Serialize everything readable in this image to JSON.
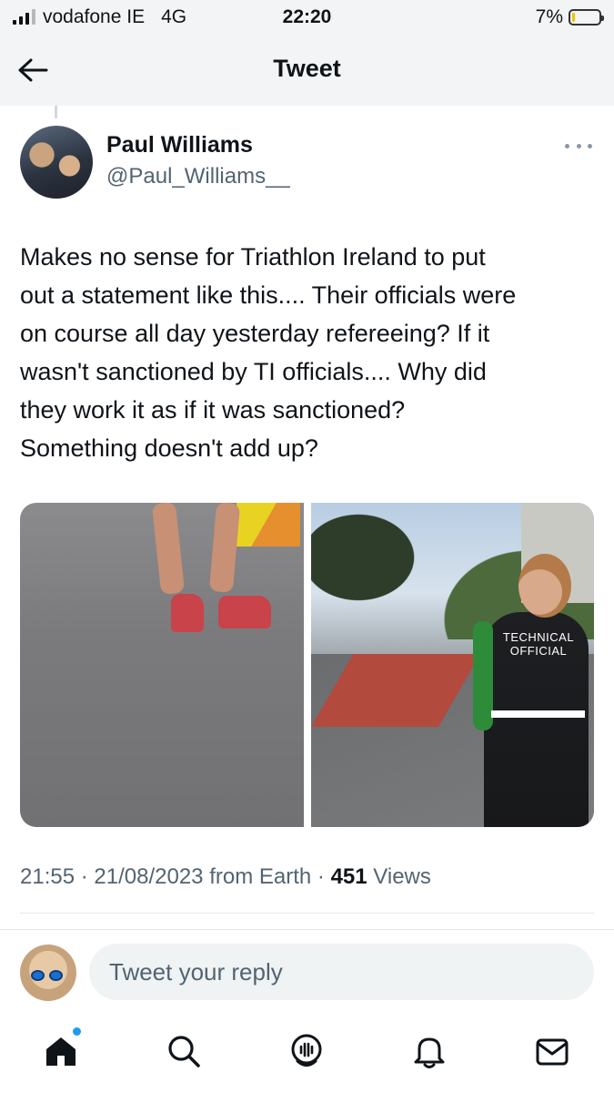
{
  "status_bar": {
    "carrier": "vodafone IE",
    "network": "4G",
    "time": "22:20",
    "battery_percent": "7%",
    "battery_level": 0.07,
    "signal_bars_active": 3,
    "signal_bars_total": 4
  },
  "header": {
    "back_icon": "arrow-left-icon",
    "title": "Tweet"
  },
  "tweet": {
    "author_name": "Paul Williams",
    "author_handle": "@Paul_Williams__",
    "more_icon": "more-horizontal-icon",
    "text": "Makes no sense for Triathlon Ireland to put\nout a statement like this.... Their officials were\non course all day yesterday refereeing? If it\nwasn't sanctioned by TI officials.... Why did\nthey work it as if it was sanctioned?\nSomething doesn't add up?",
    "media": {
      "photo_right_label": "TECHNICAL\nOFFICIAL"
    },
    "meta": {
      "time": "21:55",
      "date": "21/08/2023",
      "source": "from Earth",
      "separator": "·",
      "views_count": "451",
      "views_label": "Views"
    }
  },
  "reply": {
    "placeholder": "Tweet your reply"
  },
  "tabbar": {
    "items": [
      {
        "icon": "home-icon",
        "has_notification_dot": true
      },
      {
        "icon": "search-icon"
      },
      {
        "icon": "spaces-icon"
      },
      {
        "icon": "bell-icon"
      },
      {
        "icon": "mail-icon"
      }
    ]
  },
  "colors": {
    "accent": "#1d9bf0",
    "text_primary": "#0f1419",
    "text_secondary": "#536471",
    "header_bg": "#f3f4f5"
  }
}
